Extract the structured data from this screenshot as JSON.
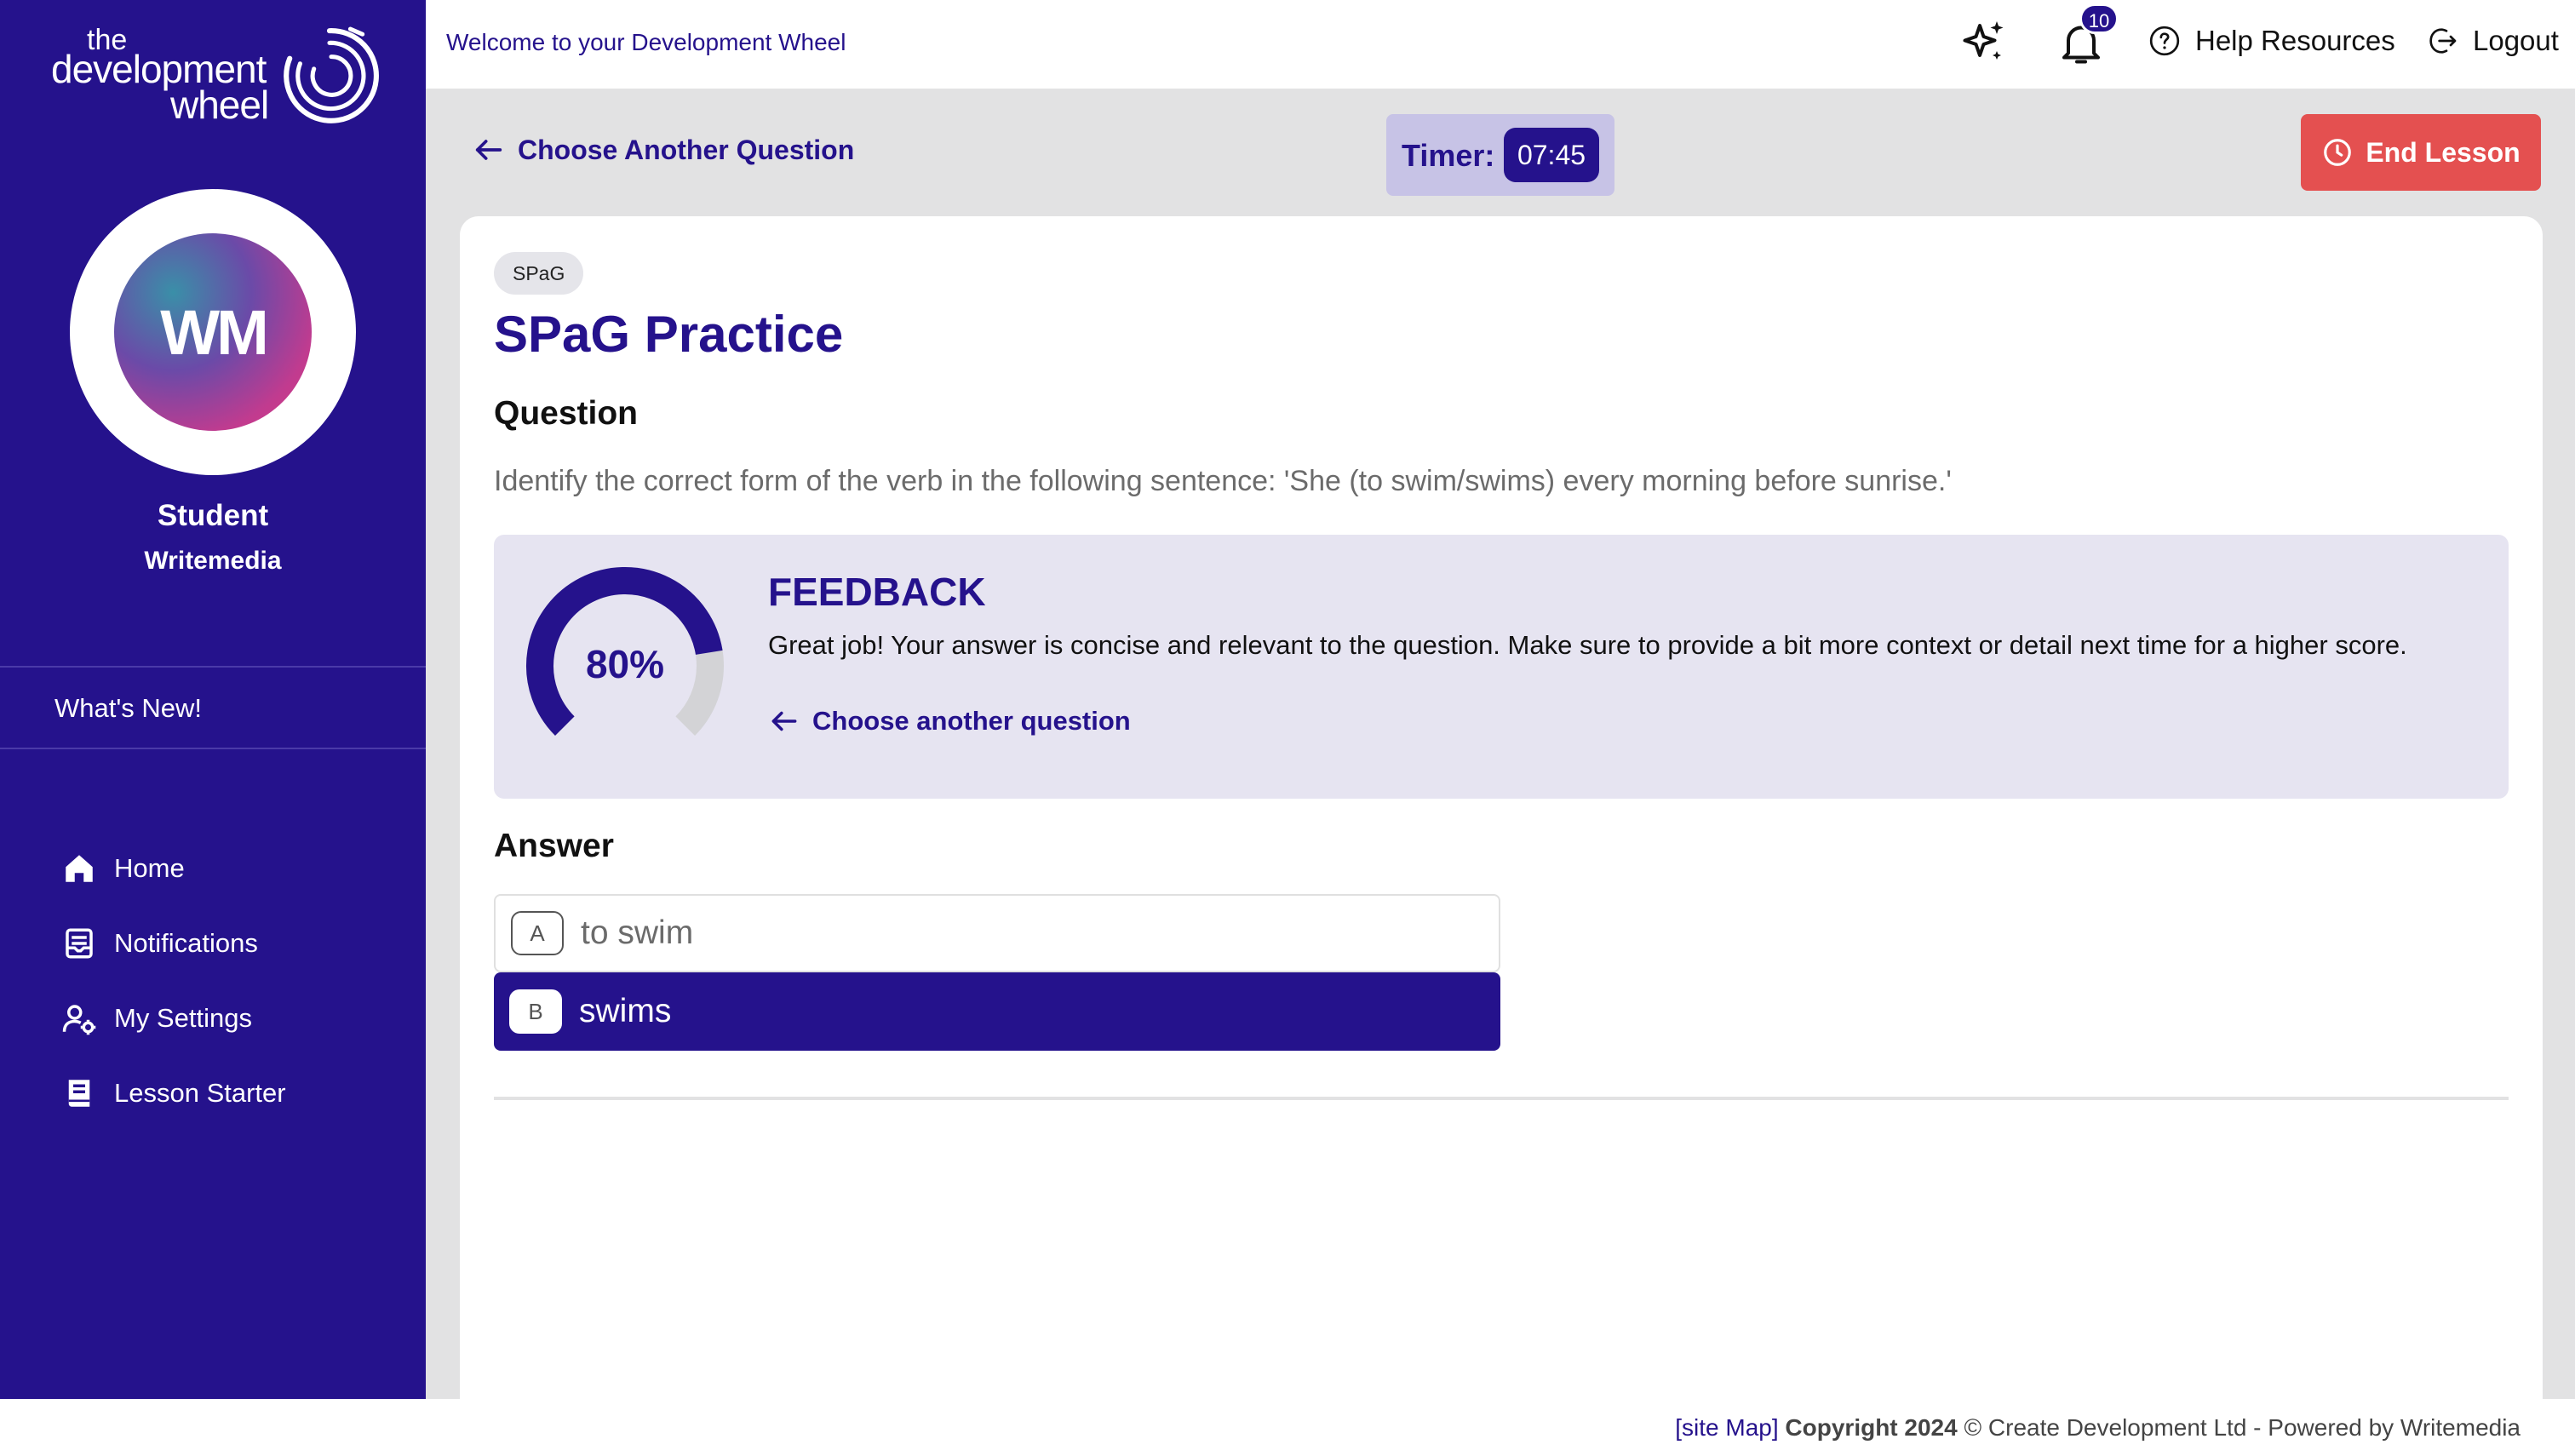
{
  "brand": {
    "logo_small": "the",
    "logo_big": "development",
    "logo_wheel": "wheel"
  },
  "user": {
    "initials": "WM",
    "name": "Student",
    "org": "Writemedia"
  },
  "sidebar": {
    "whats_new": "What's New!",
    "items": [
      {
        "label": "Home",
        "icon": "home-icon"
      },
      {
        "label": "Notifications",
        "icon": "notifications-icon"
      },
      {
        "label": "My Settings",
        "icon": "settings-user-icon"
      },
      {
        "label": "Lesson Starter",
        "icon": "book-icon"
      }
    ]
  },
  "topbar": {
    "welcome": "Welcome to your Development Wheel",
    "notification_count": "10",
    "help": "Help Resources",
    "logout": "Logout"
  },
  "lesson": {
    "back_label": "Choose Another Question",
    "timer_label": "Timer:",
    "timer_value": "07:45",
    "end_label": "End Lesson"
  },
  "question": {
    "tag": "SPaG",
    "title": "SPaG Practice",
    "section_label": "Question",
    "text": "Identify the correct form of the verb in the following sentence: 'She (to swim/swims) every morning before sunrise.'"
  },
  "feedback": {
    "score_label": "80%",
    "score": 0.8,
    "title": "FEEDBACK",
    "text": "Great job! Your answer is concise and relevant to the question. Make sure to provide a bit more context or detail next time for a higher score.",
    "link": "Choose another question"
  },
  "answer": {
    "section_label": "Answer",
    "options": [
      {
        "key": "A",
        "text": "to swim",
        "selected": false
      },
      {
        "key": "B",
        "text": "swims",
        "selected": true
      }
    ]
  },
  "footer": {
    "sitemap": "[site Map]",
    "copyright": "Copyright 2024",
    "rest": "© Create Development Ltd - Powered by Writemedia"
  },
  "colors": {
    "primary": "#25128c",
    "danger": "#e45050",
    "feedback_bg": "#e6e4f1",
    "timer_bg": "#c7c3e6"
  }
}
